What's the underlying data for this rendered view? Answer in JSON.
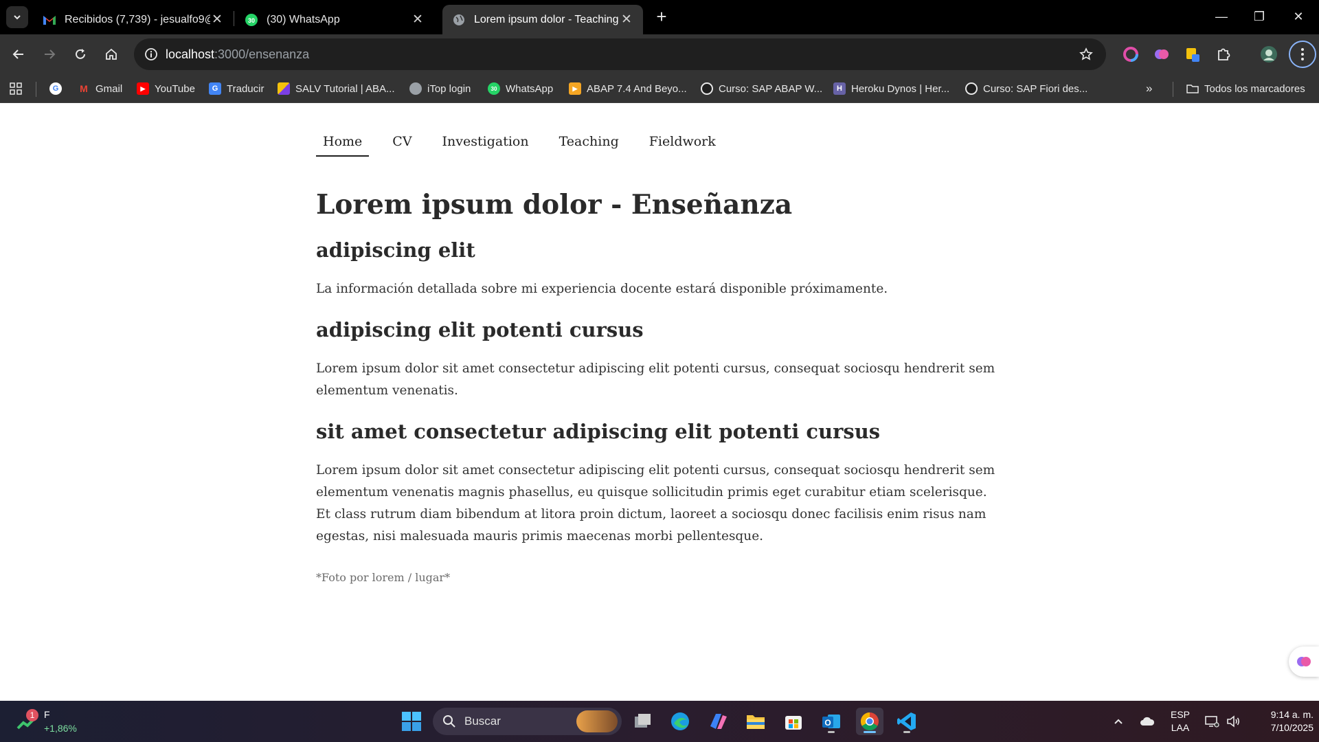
{
  "browser": {
    "tabs": [
      {
        "title": "Recibidos (7,739) - jesualfo9@g",
        "favicon": "gmail-icon",
        "active": false
      },
      {
        "title": "(30) WhatsApp",
        "favicon": "whatsapp-icon",
        "badge": "30",
        "active": false
      },
      {
        "title": "Lorem ipsum dolor - Teaching",
        "favicon": "globe-icon",
        "active": true
      }
    ],
    "address_bar": {
      "host": "localhost",
      "path": ":3000/ensenanza"
    },
    "bookmarks": [
      {
        "label": "Gmail",
        "icon": "gmail-icon"
      },
      {
        "label": "YouTube",
        "icon": "youtube-icon"
      },
      {
        "label": "Traducir",
        "icon": "translate-icon"
      },
      {
        "label": "SALV Tutorial | ABA...",
        "icon": "salv-icon"
      },
      {
        "label": "iTop login",
        "icon": "globe-icon"
      },
      {
        "label": "WhatsApp",
        "icon": "whatsapp-icon",
        "badge": "30"
      },
      {
        "label": "ABAP 7.4 And Beyo...",
        "icon": "bookmark-doc-icon"
      },
      {
        "label": "Curso: SAP ABAP W...",
        "icon": "udemy-icon"
      },
      {
        "label": "Heroku Dynos | Her...",
        "icon": "heroku-icon"
      },
      {
        "label": "Curso: SAP Fiori des...",
        "icon": "udemy-icon"
      }
    ],
    "all_bookmarks_label": "Todos los marcadores"
  },
  "page": {
    "nav": [
      "Home",
      "CV",
      "Investigation",
      "Teaching",
      "Fieldwork"
    ],
    "active_nav": "Home",
    "title": "Lorem ipsum dolor - Enseñanza",
    "sections": [
      {
        "heading": "adipiscing elit",
        "text": "La información detallada sobre mi experiencia docente estará disponible próximamente."
      },
      {
        "heading": "adipiscing elit potenti cursus",
        "text": "Lorem ipsum dolor sit amet consectetur adipiscing elit potenti cursus, consequat sociosqu hendrerit sem elementum venenatis."
      },
      {
        "heading": "sit amet consectetur adipiscing elit potenti cursus",
        "text": "Lorem ipsum dolor sit amet consectetur adipiscing elit potenti cursus, consequat sociosqu hendrerit sem elementum venenatis magnis phasellus, eu quisque sollicitudin primis eget curabitur etiam scelerisque. Et class rutrum diam bibendum at litora proin dictum, laoreet a sociosqu donec facilisis enim risus nam egestas, nisi malesuada mauris primis maecenas morbi pellentesque."
      }
    ],
    "caption": "*Foto por lorem / lugar*"
  },
  "taskbar": {
    "stock": {
      "symbol": "F",
      "change": "+1,86%",
      "badge": "1"
    },
    "search_label": "Buscar",
    "language": {
      "lang": "ESP",
      "layout": "LAA"
    },
    "clock": {
      "time": "9:14 a. m.",
      "date": "7/10/2025"
    }
  },
  "colors": {
    "accent_active_app": "#6fc3ff",
    "tab_active_bg": "#333333",
    "page_text": "#222222"
  }
}
